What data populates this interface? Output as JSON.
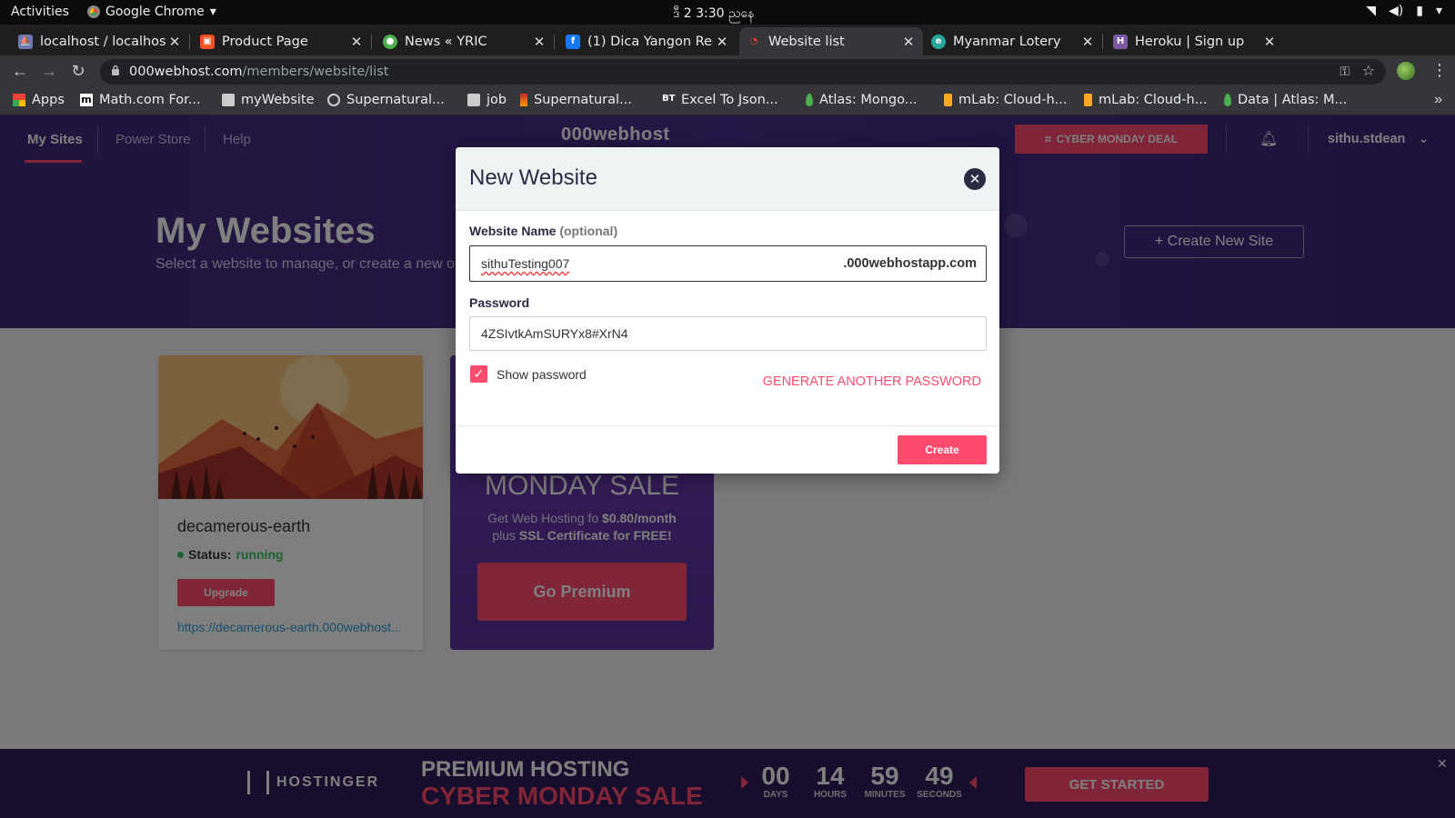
{
  "system_bar": {
    "activities": "Activities",
    "app_name": "Google Chrome",
    "clock": "ဒီ 2  3:30 ညနေ"
  },
  "tabs": [
    {
      "label": "localhost / localhost",
      "active": false,
      "icon": "phpmyadmin-icon"
    },
    {
      "label": "Product Page",
      "active": false,
      "icon": "product-page-icon"
    },
    {
      "label": "News « YRIC",
      "active": false,
      "icon": "yric-icon"
    },
    {
      "label": "(1) Dica Yangon Reg",
      "active": false,
      "icon": "facebook-icon"
    },
    {
      "label": "Website list",
      "active": true,
      "icon": "000webhost-icon"
    },
    {
      "label": "Myanmar Lotery",
      "active": false,
      "icon": "lottery-icon"
    },
    {
      "label": "Heroku | Sign up",
      "active": false,
      "icon": "heroku-icon"
    }
  ],
  "address_bar": {
    "domain": "000webhost.com",
    "path": "/members/website/list"
  },
  "bookmarks": [
    {
      "label": "Apps",
      "icon": "apps-grid-icon"
    },
    {
      "label": "Math.com For...",
      "icon": "mathcom-icon"
    },
    {
      "label": "myWebsite",
      "icon": "folder-icon"
    },
    {
      "label": "Supernatural...",
      "icon": "globe-icon"
    },
    {
      "label": "job",
      "icon": "folder-icon"
    },
    {
      "label": "Supernatural...",
      "icon": "supernatural-icon"
    },
    {
      "label": "Excel To Json...",
      "icon": "beautifytools-icon"
    },
    {
      "label": "Atlas: Mongo...",
      "icon": "mongodb-leaf-icon"
    },
    {
      "label": "mLab: Cloud-h...",
      "icon": "mlab-icon"
    },
    {
      "label": "mLab: Cloud-h...",
      "icon": "mlab-icon"
    },
    {
      "label": "Data | Atlas: M...",
      "icon": "mongodb-leaf-icon"
    }
  ],
  "site_nav": {
    "my_sites": "My Sites",
    "power_store": "Power Store",
    "help": "Help",
    "logo": "000webhost",
    "deal": "CYBER MONDAY DEAL",
    "user": "sithu.stdean"
  },
  "hero": {
    "title": "My Websites",
    "subtitle": "Select a website to manage, or create a new o",
    "create_button": "+  Create New Site"
  },
  "site_card": {
    "name": "decamerous-earth",
    "status_label": "Status:",
    "status_value": "running",
    "upgrade": "Upgrade",
    "link": "https://decamerous-earth.000webhost..."
  },
  "promo": {
    "headline": "MONDAY SALE",
    "line1_prefix": "Get Web Hosting fo ",
    "line1_price": "$0.80/month",
    "line2_prefix": "plus ",
    "line2_bold": "SSL Certificate for FREE!",
    "button": "Go Premium"
  },
  "banner": {
    "brand": "HOSTINGER",
    "line1": "PREMIUM HOSTING",
    "line2": "CYBER MONDAY SALE",
    "countdown": [
      {
        "value": "00",
        "unit": "DAYS"
      },
      {
        "value": "14",
        "unit": "HOURS"
      },
      {
        "value": "59",
        "unit": "MINUTES"
      },
      {
        "value": "49",
        "unit": "SECONDS"
      }
    ],
    "cta": "GET STARTED"
  },
  "modal": {
    "title": "New Website",
    "name_label": "Website Name",
    "name_optional": "(optional)",
    "name_value": "sithuTesting007",
    "name_suffix": ".000webhostapp.com",
    "password_label": "Password",
    "password_value": "4ZSIvtkAmSURYx8#XrN4",
    "show_password": "Show password",
    "show_password_checked": true,
    "generate": "GENERATE ANOTHER PASSWORD",
    "create": "Create"
  },
  "colors": {
    "accent": "#ff4b6e",
    "brand_purple": "#4a2f8e",
    "status_green": "#3ac463"
  }
}
